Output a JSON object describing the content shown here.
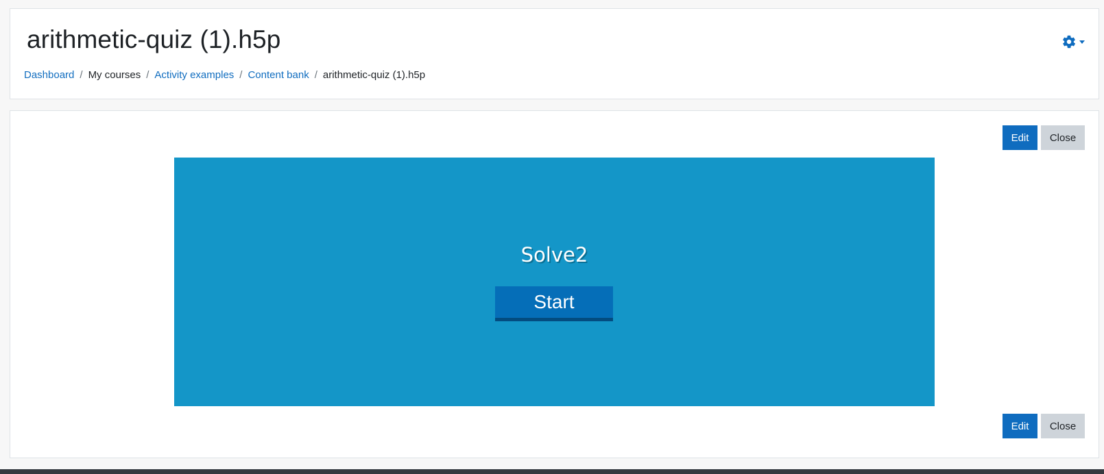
{
  "page": {
    "title": "arithmetic-quiz (1).h5p"
  },
  "breadcrumb": {
    "items": [
      {
        "label": "Dashboard",
        "link": true
      },
      {
        "label": "My courses",
        "link": false
      },
      {
        "label": "Activity examples",
        "link": true
      },
      {
        "label": "Content bank",
        "link": true
      },
      {
        "label": "arithmetic-quiz (1).h5p",
        "link": false
      }
    ],
    "separator": "/"
  },
  "settings": {
    "icon": "gear-icon"
  },
  "actions": {
    "edit_label": "Edit",
    "close_label": "Close"
  },
  "h5p": {
    "quiz_title": "Solve2",
    "start_label": "Start"
  },
  "colors": {
    "accent": "#0f6cbf",
    "h5p_background": "#1496c8",
    "start_button": "#056eb8"
  }
}
